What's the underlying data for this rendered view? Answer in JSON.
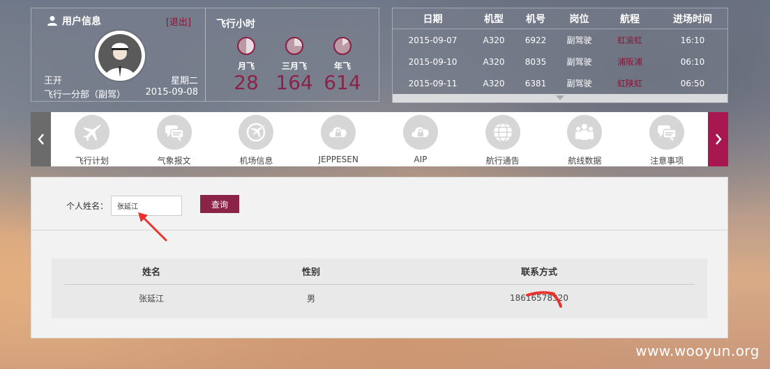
{
  "user_panel": {
    "title": "用户信息",
    "logout": "[退出]",
    "name": "王开",
    "weekday": "星期二",
    "department": "飞行一分部（副驾）",
    "date": "2015-09-08"
  },
  "hours_panel": {
    "title": "飞行小时",
    "items": [
      {
        "label": "月飞",
        "value": "28",
        "fraction": 0.5
      },
      {
        "label": "三月飞",
        "value": "164",
        "fraction": 0.25
      },
      {
        "label": "年飞",
        "value": "614",
        "fraction": 0.15
      }
    ]
  },
  "schedule": {
    "headers": [
      "日期",
      "机型",
      "机号",
      "岗位",
      "航程",
      "进场时间"
    ],
    "rows": [
      [
        "2015-09-07",
        "A320",
        "6922",
        "副驾驶",
        "虹渝虹",
        "16:10"
      ],
      [
        "2015-09-10",
        "A320",
        "8035",
        "副驾驶",
        "浦阪浦",
        "06:10"
      ],
      [
        "2015-09-11",
        "A320",
        "6381",
        "副驾驶",
        "虹陕虹",
        "06:50"
      ]
    ]
  },
  "nav": {
    "items": [
      {
        "label": "飞行计划",
        "icon": "airplane-icon"
      },
      {
        "label": "气象报文",
        "icon": "chat-icon"
      },
      {
        "label": "机场信息",
        "icon": "globe-plane-icon"
      },
      {
        "label": "JEPPESEN",
        "icon": "cloud-lock-icon"
      },
      {
        "label": "AIP",
        "icon": "cloud-lock-icon"
      },
      {
        "label": "航行通告",
        "icon": "globe-icon"
      },
      {
        "label": "航线数据",
        "icon": "people-icon"
      },
      {
        "label": "注意事项",
        "icon": "chat-icon"
      }
    ]
  },
  "search": {
    "label": "个人姓名：",
    "value": "张延江",
    "button": "查询"
  },
  "result": {
    "headers": [
      "姓名",
      "性别",
      "联系方式"
    ],
    "row": [
      "张延江",
      "男",
      "18616578320"
    ]
  },
  "watermark": "www.wooyun.org",
  "colors": {
    "accent": "#8b2348",
    "nav_right": "#a8174f",
    "nav_left": "#6b6b6b"
  }
}
